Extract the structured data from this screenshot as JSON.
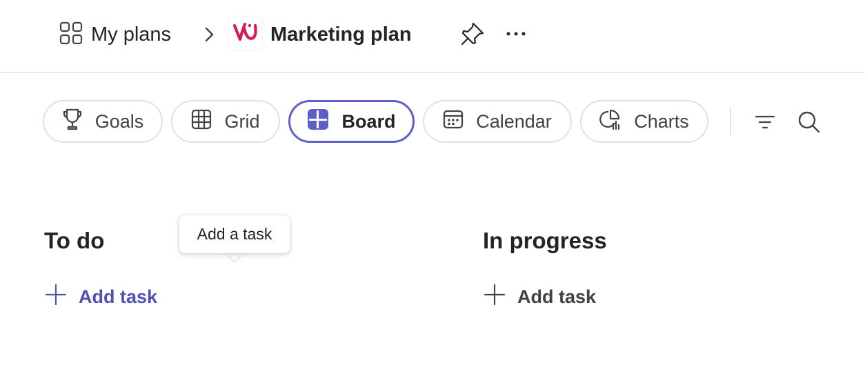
{
  "header": {
    "breadcrumb_root": "My plans",
    "plan_title": "Marketing plan",
    "icons": [
      "grid-apps-icon",
      "chevron-right-icon",
      "plan-logo-icon",
      "pin-icon",
      "more-icon"
    ]
  },
  "tabs": [
    {
      "label": "Goals",
      "icon": "trophy-icon",
      "active": false
    },
    {
      "label": "Grid",
      "icon": "table-icon",
      "active": false
    },
    {
      "label": "Board",
      "icon": "board-icon",
      "active": true
    },
    {
      "label": "Calendar",
      "icon": "calendar-icon",
      "active": false
    },
    {
      "label": "Charts",
      "icon": "chart-icon",
      "active": false
    }
  ],
  "toolbar": {
    "icons": [
      "filter-icon",
      "search-icon"
    ]
  },
  "columns": [
    {
      "title": "To do",
      "add_label": "Add task"
    },
    {
      "title": "In progress",
      "add_label": "Add task"
    }
  ],
  "tooltip": {
    "text": "Add a task"
  },
  "colors": {
    "accent": "#5b5fc7",
    "accent_text": "#4f52b2",
    "logo": "#d6195b",
    "text": "#242424"
  }
}
